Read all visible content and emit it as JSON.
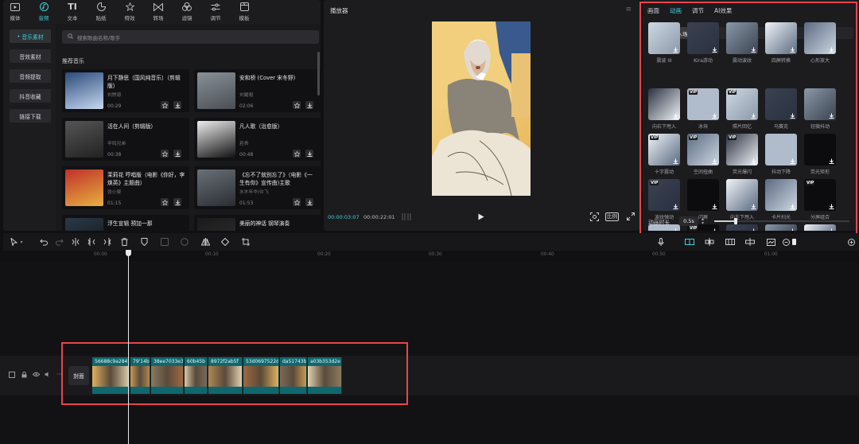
{
  "top_tabs": [
    {
      "label": "媒体",
      "icon": "media-icon"
    },
    {
      "label": "音频",
      "icon": "audio-icon",
      "active": true
    },
    {
      "label": "文本",
      "icon": "text-icon"
    },
    {
      "label": "贴纸",
      "icon": "sticker-icon"
    },
    {
      "label": "特效",
      "icon": "effects-icon"
    },
    {
      "label": "转场",
      "icon": "transition-icon"
    },
    {
      "label": "滤镜",
      "icon": "filter-icon"
    },
    {
      "label": "调节",
      "icon": "adjust-icon"
    },
    {
      "label": "模板",
      "icon": "template-icon"
    }
  ],
  "side_categories": [
    {
      "label": "音乐素材",
      "active": true
    },
    {
      "label": "音效素材"
    },
    {
      "label": "音频提取"
    },
    {
      "label": "抖音收藏"
    },
    {
      "label": "链接下载"
    }
  ],
  "search": {
    "placeholder": "搜索歌曲名称/歌手"
  },
  "recommended_label": "推荐音乐",
  "music": [
    {
      "title": "月下静思（国风纯音乐）（剪辑版）",
      "artist": "刘崇恩",
      "duration": "00:29",
      "colors": [
        "#2a4a7a",
        "#c8d8f0"
      ]
    },
    {
      "title": "安和桥 (Cover 宋冬野)",
      "artist": "刘耀祖",
      "duration": "02:06",
      "colors": [
        "#8a9098",
        "#4a4f55"
      ]
    },
    {
      "title": "活在人间（剪辑版）",
      "artist": "辛鸣兄弟",
      "duration": "00:38",
      "colors": [
        "#555",
        "#222"
      ]
    },
    {
      "title": "凡人歌（治愈版）",
      "artist": "若贵",
      "duration": "00:48",
      "colors": [
        "#eee",
        "#111"
      ]
    },
    {
      "title": "茉莉花 哼唱版（电影《你好，李焕英》主题曲）",
      "artist": "张小斐",
      "duration": "01:15",
      "colors": [
        "#c0302a",
        "#e8b040"
      ]
    },
    {
      "title": "《忘不了就别忘了》（电影《一生有你》宣传曲)主歌",
      "artist": "水木年华/许飞",
      "duration": "01:53",
      "colors": [
        "#6a7078",
        "#2a2e33"
      ]
    },
    {
      "title": "浮生宣辑 预加一那",
      "artist": "",
      "duration": "",
      "colors": [
        "#2a3a4a",
        "#111"
      ]
    },
    {
      "title": "美丽的神话 钢琴演奏",
      "artist": "",
      "duration": "",
      "colors": [
        "#1a1a1a",
        "#333"
      ]
    }
  ],
  "player": {
    "title": "播放器",
    "current_time": "00:00:03:07",
    "total_time": "00:00:22:01",
    "ratio_label": "比例"
  },
  "inspector": {
    "tabs": [
      "画面",
      "动画",
      "调节",
      "AI效果"
    ],
    "active_tab": "动画",
    "subtabs": [
      "入场",
      "出场",
      "组合"
    ],
    "active_subtab": "入场",
    "effects": [
      {
        "label": "震波 III",
        "vip": false
      },
      {
        "label": "Kira游动",
        "vip": false
      },
      {
        "label": "震动波纹",
        "vip": false
      },
      {
        "label": "四屏转换",
        "vip": false
      },
      {
        "label": "心形放大",
        "vip": false
      },
      {
        "label": "向右下甩入",
        "vip": false
      },
      {
        "label": "冰块",
        "vip": true
      },
      {
        "label": "照片回忆",
        "vip": true
      },
      {
        "label": "马赛克",
        "vip": false
      },
      {
        "label": "轻微抖动",
        "vip": false
      },
      {
        "label": "十字震动",
        "vip": true
      },
      {
        "label": "空间扭曲",
        "vip": true
      },
      {
        "label": "荧光爆闪",
        "vip": true
      },
      {
        "label": "抖动下降",
        "vip": false
      },
      {
        "label": "荧光矩形",
        "vip": false
      },
      {
        "label": "波纹弹动",
        "vip": true
      },
      {
        "label": "闪屏",
        "vip": false
      },
      {
        "label": "向左下甩入",
        "vip": false
      },
      {
        "label": "卡片扫光",
        "vip": false
      },
      {
        "label": "分屏组合",
        "vip": true
      },
      {
        "label": "",
        "vip": false
      },
      {
        "label": "",
        "vip": true
      },
      {
        "label": "",
        "vip": false
      },
      {
        "label": "",
        "vip": false
      },
      {
        "label": "",
        "vip": false
      }
    ],
    "duration_label": "动画时长",
    "duration_value": "0.5s",
    "duration_fraction": 0.16
  },
  "timeline": {
    "ticks": [
      "00:00",
      "00:10",
      "00:20",
      "00:30",
      "00:40",
      "00:50",
      "01:00"
    ],
    "cover_label": "封面",
    "clips": [
      "56688c9a284",
      "79'14b7",
      "38ee7033e3",
      "60b45b",
      "8972f2ab5f",
      "53d0697522d",
      "da51743b",
      "a03b353d2e"
    ]
  },
  "colors": {
    "accent": "#3fd0d8",
    "highlight_box": "#e8444a",
    "clip": "#10686e"
  }
}
